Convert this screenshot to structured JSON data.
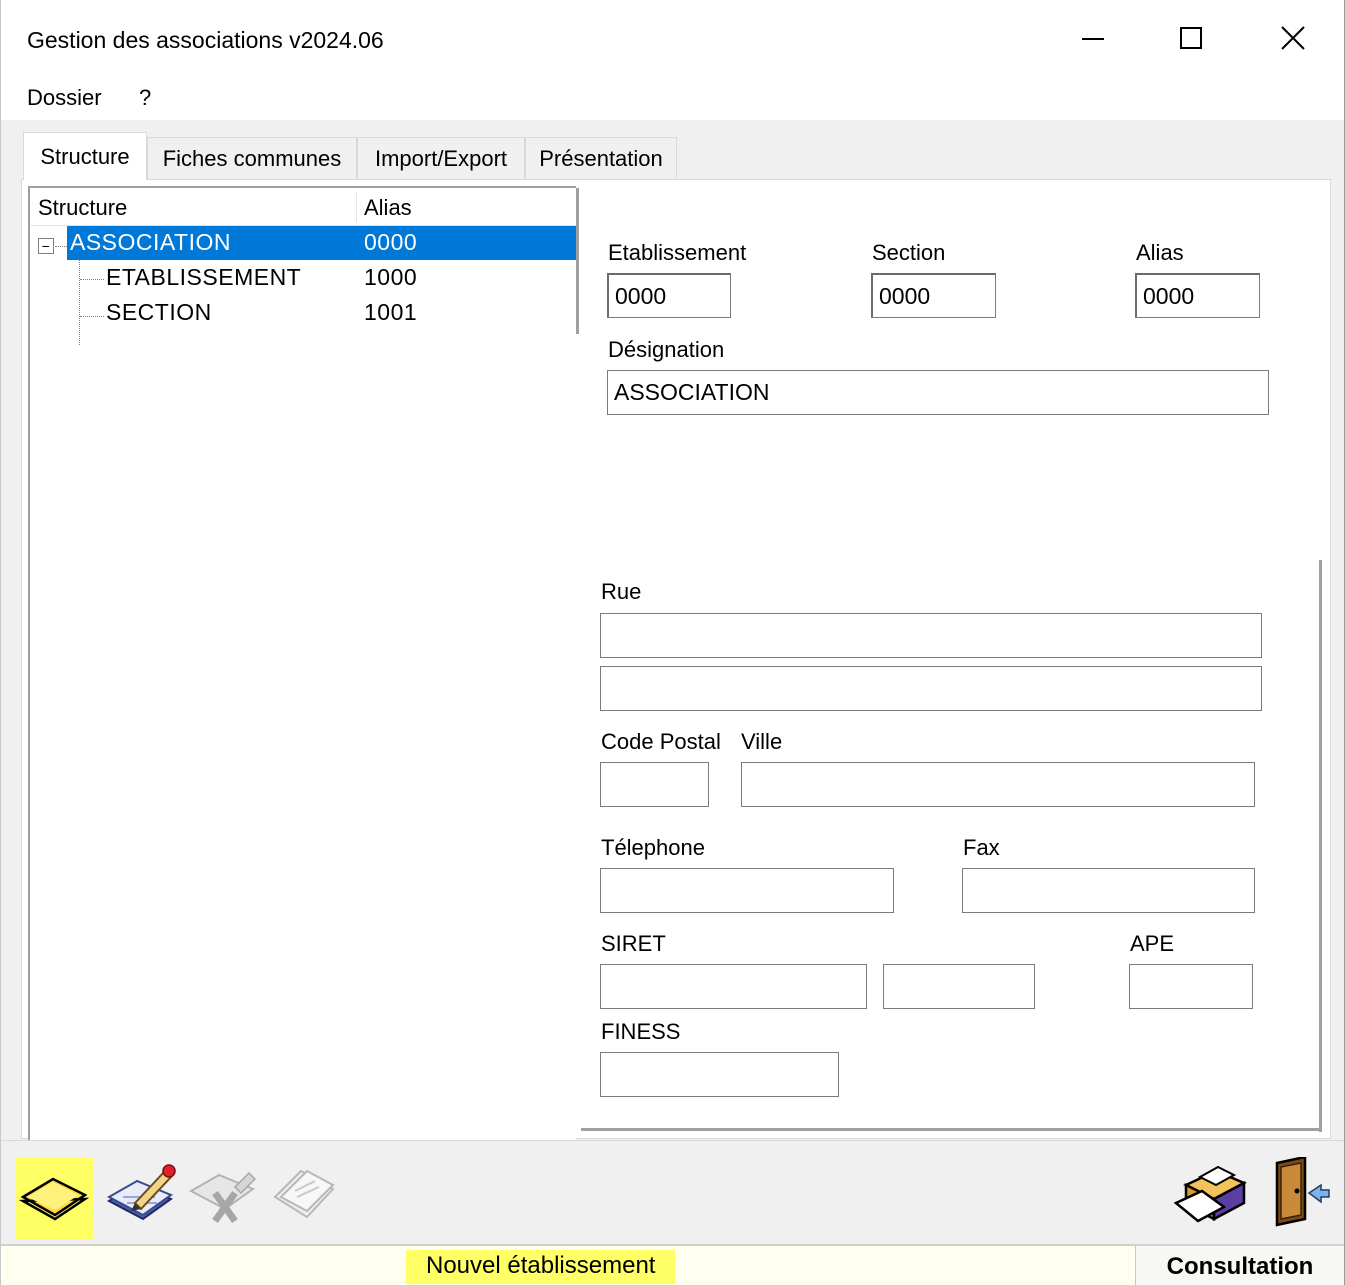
{
  "window": {
    "title": "Gestion des associations v2024.06",
    "minimize_icon": "minimize-icon",
    "maximize_icon": "maximize-icon",
    "close_icon": "close-icon"
  },
  "menu": {
    "items": [
      "Dossier",
      "?"
    ]
  },
  "tabs": [
    {
      "label": "Structure",
      "active": true
    },
    {
      "label": "Fiches communes",
      "active": false
    },
    {
      "label": "Import/Export",
      "active": false
    },
    {
      "label": "Présentation",
      "active": false
    }
  ],
  "tree": {
    "columns": [
      "Structure",
      "Alias"
    ],
    "expander_symbol": "−",
    "rows": [
      {
        "name": "ASSOCIATION",
        "alias": "0000",
        "selected": true
      },
      {
        "name": "ETABLISSEMENT",
        "alias": "1000",
        "selected": false
      },
      {
        "name": "SECTION",
        "alias": "1001",
        "selected": false
      }
    ]
  },
  "form": {
    "etablissement": {
      "label": "Etablissement",
      "value": "0000"
    },
    "section": {
      "label": "Section",
      "value": "0000"
    },
    "alias": {
      "label": "Alias",
      "value": "0000"
    },
    "designation": {
      "label": "Désignation",
      "value": "ASSOCIATION"
    },
    "rue": {
      "label": "Rue",
      "value1": "",
      "value2": ""
    },
    "code_postal": {
      "label": "Code Postal",
      "value": ""
    },
    "ville": {
      "label": "Ville",
      "value": ""
    },
    "telephone": {
      "label": "Télephone",
      "value": ""
    },
    "fax": {
      "label": "Fax",
      "value": ""
    },
    "siret": {
      "label": "SIRET",
      "value1": "",
      "value2": ""
    },
    "ape": {
      "label": "APE",
      "value": ""
    },
    "finess": {
      "label": "FINESS",
      "value": ""
    }
  },
  "toolbar": {
    "tools": [
      "new-establishment-icon",
      "edit-icon",
      "delete-icon",
      "copy-icon",
      "print-icon",
      "exit-door-icon"
    ],
    "highlight_color": "#ffff66"
  },
  "status": {
    "message": "Nouvel établissement",
    "mode": "Consultation"
  },
  "colors": {
    "selection": "#0078d7",
    "highlight": "#ffff66"
  }
}
